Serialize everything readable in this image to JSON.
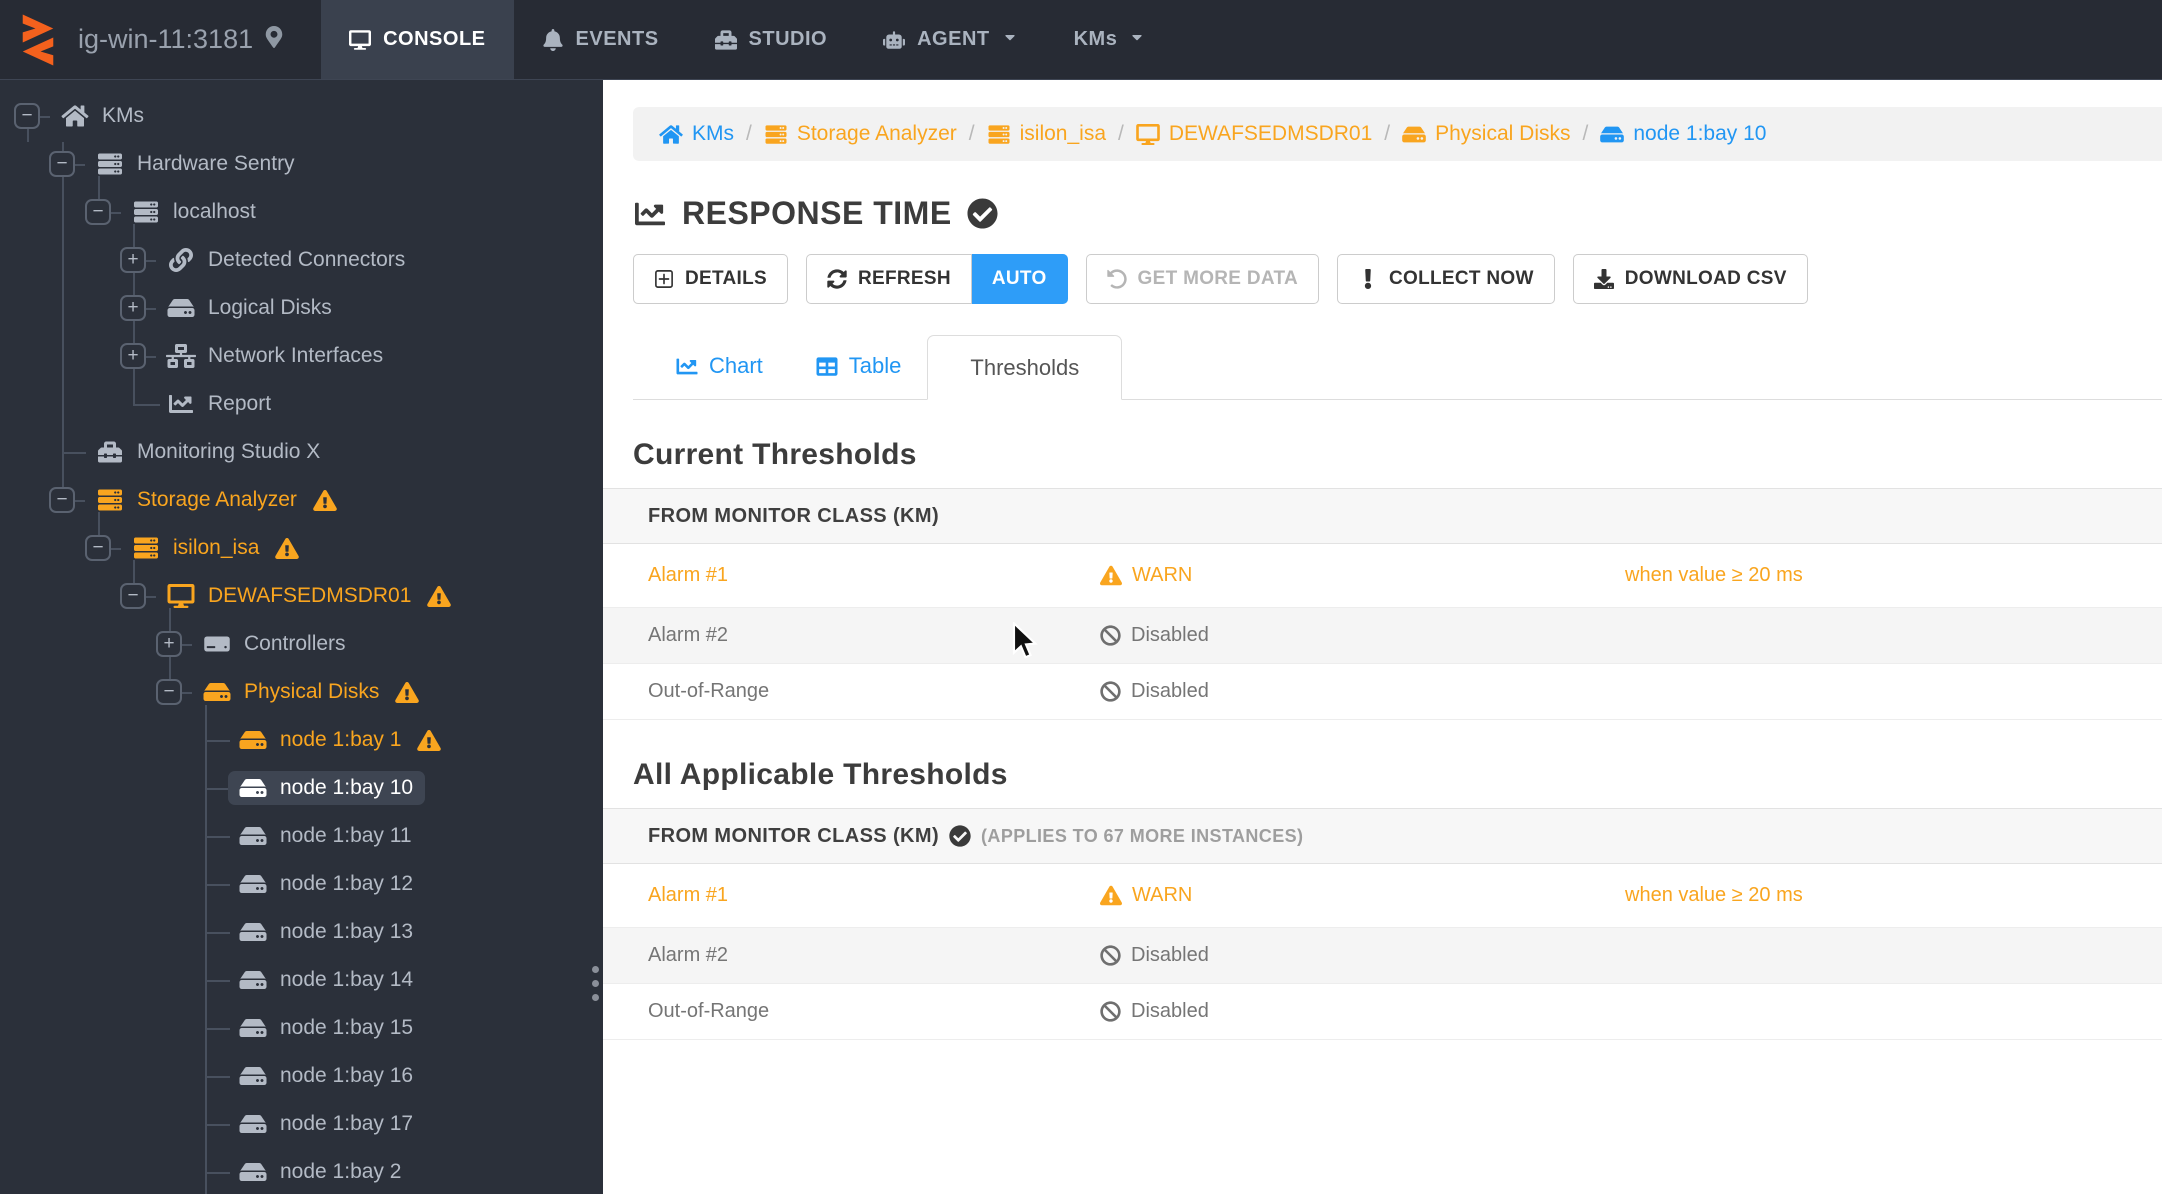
{
  "navbar": {
    "host": "ig-win-11:3181",
    "items": [
      {
        "label": "CONSOLE",
        "icon": "desktop",
        "active": true,
        "caret": false
      },
      {
        "label": "EVENTS",
        "icon": "bell",
        "active": false,
        "caret": false
      },
      {
        "label": "STUDIO",
        "icon": "toolbox",
        "active": false,
        "caret": false
      },
      {
        "label": "AGENT",
        "icon": "robot",
        "active": false,
        "caret": true
      },
      {
        "label": "KMs",
        "icon": "",
        "active": false,
        "caret": true
      }
    ]
  },
  "sidebar": {
    "tree": [
      {
        "label": "KMs",
        "icon": "home",
        "level": 0,
        "expander": "minus",
        "orange": false,
        "warn": false,
        "selected": false
      },
      {
        "label": "Hardware Sentry",
        "icon": "server",
        "level": 1,
        "expander": "minus",
        "orange": false,
        "warn": false,
        "selected": false
      },
      {
        "label": "localhost",
        "icon": "server",
        "level": 2,
        "expander": "minus",
        "orange": false,
        "warn": false,
        "selected": false
      },
      {
        "label": "Detected Connectors",
        "icon": "link",
        "level": 3,
        "expander": "plus",
        "orange": false,
        "warn": false,
        "selected": false
      },
      {
        "label": "Logical Disks",
        "icon": "hdd",
        "level": 3,
        "expander": "plus",
        "orange": false,
        "warn": false,
        "selected": false
      },
      {
        "label": "Network Interfaces",
        "icon": "network",
        "level": 3,
        "expander": "plus",
        "orange": false,
        "warn": false,
        "selected": false
      },
      {
        "label": "Report",
        "icon": "chart",
        "level": 3,
        "expander": "none",
        "orange": false,
        "warn": false,
        "selected": false
      },
      {
        "label": "Monitoring Studio X",
        "icon": "toolbox",
        "level": 1,
        "expander": "none",
        "orange": false,
        "warn": false,
        "selected": false
      },
      {
        "label": "Storage Analyzer",
        "icon": "server",
        "level": 1,
        "expander": "minus",
        "orange": true,
        "warn": true,
        "selected": false
      },
      {
        "label": "isilon_isa",
        "icon": "server",
        "level": 2,
        "expander": "minus",
        "orange": true,
        "warn": true,
        "selected": false
      },
      {
        "label": "DEWAFSEDMSDR01",
        "icon": "desktop",
        "level": 3,
        "expander": "minus",
        "orange": true,
        "warn": true,
        "selected": false
      },
      {
        "label": "Controllers",
        "icon": "controller",
        "level": 4,
        "expander": "plus",
        "orange": false,
        "warn": false,
        "selected": false
      },
      {
        "label": "Physical Disks",
        "icon": "hdd",
        "level": 4,
        "expander": "minus",
        "orange": true,
        "warn": true,
        "selected": false
      },
      {
        "label": "node 1:bay 1",
        "icon": "hdd",
        "level": 5,
        "expander": "none",
        "orange": true,
        "warn": true,
        "selected": false
      },
      {
        "label": "node 1:bay 10",
        "icon": "hdd",
        "level": 5,
        "expander": "none",
        "orange": false,
        "warn": false,
        "selected": true
      },
      {
        "label": "node 1:bay 11",
        "icon": "hdd",
        "level": 5,
        "expander": "none",
        "orange": false,
        "warn": false,
        "selected": false
      },
      {
        "label": "node 1:bay 12",
        "icon": "hdd",
        "level": 5,
        "expander": "none",
        "orange": false,
        "warn": false,
        "selected": false
      },
      {
        "label": "node 1:bay 13",
        "icon": "hdd",
        "level": 5,
        "expander": "none",
        "orange": false,
        "warn": false,
        "selected": false
      },
      {
        "label": "node 1:bay 14",
        "icon": "hdd",
        "level": 5,
        "expander": "none",
        "orange": false,
        "warn": false,
        "selected": false
      },
      {
        "label": "node 1:bay 15",
        "icon": "hdd",
        "level": 5,
        "expander": "none",
        "orange": false,
        "warn": false,
        "selected": false
      },
      {
        "label": "node 1:bay 16",
        "icon": "hdd",
        "level": 5,
        "expander": "none",
        "orange": false,
        "warn": false,
        "selected": false
      },
      {
        "label": "node 1:bay 17",
        "icon": "hdd",
        "level": 5,
        "expander": "none",
        "orange": false,
        "warn": false,
        "selected": false
      },
      {
        "label": "node 1:bay 2",
        "icon": "hdd",
        "level": 5,
        "expander": "none",
        "orange": false,
        "warn": false,
        "selected": false
      }
    ]
  },
  "breadcrumb": [
    {
      "label": "KMs",
      "icon": "home",
      "color": "blue"
    },
    {
      "label": "Storage Analyzer",
      "icon": "server",
      "color": "orange"
    },
    {
      "label": "isilon_isa",
      "icon": "server",
      "color": "orange"
    },
    {
      "label": "DEWAFSEDMSDR01",
      "icon": "desktop",
      "color": "orange"
    },
    {
      "label": "Physical Disks",
      "icon": "hdd",
      "color": "orange"
    },
    {
      "label": "node 1:bay 10",
      "icon": "hdd",
      "color": "blue"
    }
  ],
  "page": {
    "title": "RESPONSE TIME"
  },
  "toolbar": [
    {
      "label": "DETAILS",
      "icon": "plussquare",
      "style": "normal",
      "joinNext": false
    },
    {
      "label": "REFRESH",
      "icon": "refresh",
      "style": "normal",
      "joinNext": true
    },
    {
      "label": "AUTO",
      "icon": "",
      "style": "primary",
      "joinNext": false
    },
    {
      "label": "GET MORE DATA",
      "icon": "history",
      "style": "disabled",
      "joinNext": false
    },
    {
      "label": "COLLECT NOW",
      "icon": "exclam",
      "style": "normal",
      "joinNext": false
    },
    {
      "label": "DOWNLOAD CSV",
      "icon": "download",
      "style": "normal",
      "joinNext": false
    }
  ],
  "tabs": [
    {
      "label": "Chart",
      "icon": "chart",
      "active": false
    },
    {
      "label": "Table",
      "icon": "table",
      "active": false
    },
    {
      "label": "Thresholds",
      "icon": "",
      "active": true
    }
  ],
  "sections": [
    {
      "heading": "Current Thresholds",
      "header_label": "FROM MONITOR CLASS (KM)",
      "header_check": false,
      "header_note": "",
      "rows": [
        {
          "name": "Alarm #1",
          "status": "WARN",
          "status_icon": "warn",
          "condition": "when value ≥ 20 ms",
          "highlight": true
        },
        {
          "name": "Alarm #2",
          "status": "Disabled",
          "status_icon": "ban",
          "condition": "",
          "highlight": false
        },
        {
          "name": "Out-of-Range",
          "status": "Disabled",
          "status_icon": "ban",
          "condition": "",
          "highlight": false
        }
      ]
    },
    {
      "heading": "All Applicable Thresholds",
      "header_label": "FROM MONITOR CLASS (KM)",
      "header_check": true,
      "header_note": "(APPLIES TO 67 MORE INSTANCES)",
      "rows": [
        {
          "name": "Alarm #1",
          "status": "WARN",
          "status_icon": "warn",
          "condition": "when value ≥ 20 ms",
          "highlight": true
        },
        {
          "name": "Alarm #2",
          "status": "Disabled",
          "status_icon": "ban",
          "condition": "",
          "highlight": false
        },
        {
          "name": "Out-of-Range",
          "status": "Disabled",
          "status_icon": "ban",
          "condition": "",
          "highlight": false
        }
      ]
    }
  ],
  "colors": {
    "accent_orange": "#f9a51f",
    "accent_blue": "#2196f3",
    "nav_bg": "#272b34",
    "side_bg": "#2b303a"
  }
}
